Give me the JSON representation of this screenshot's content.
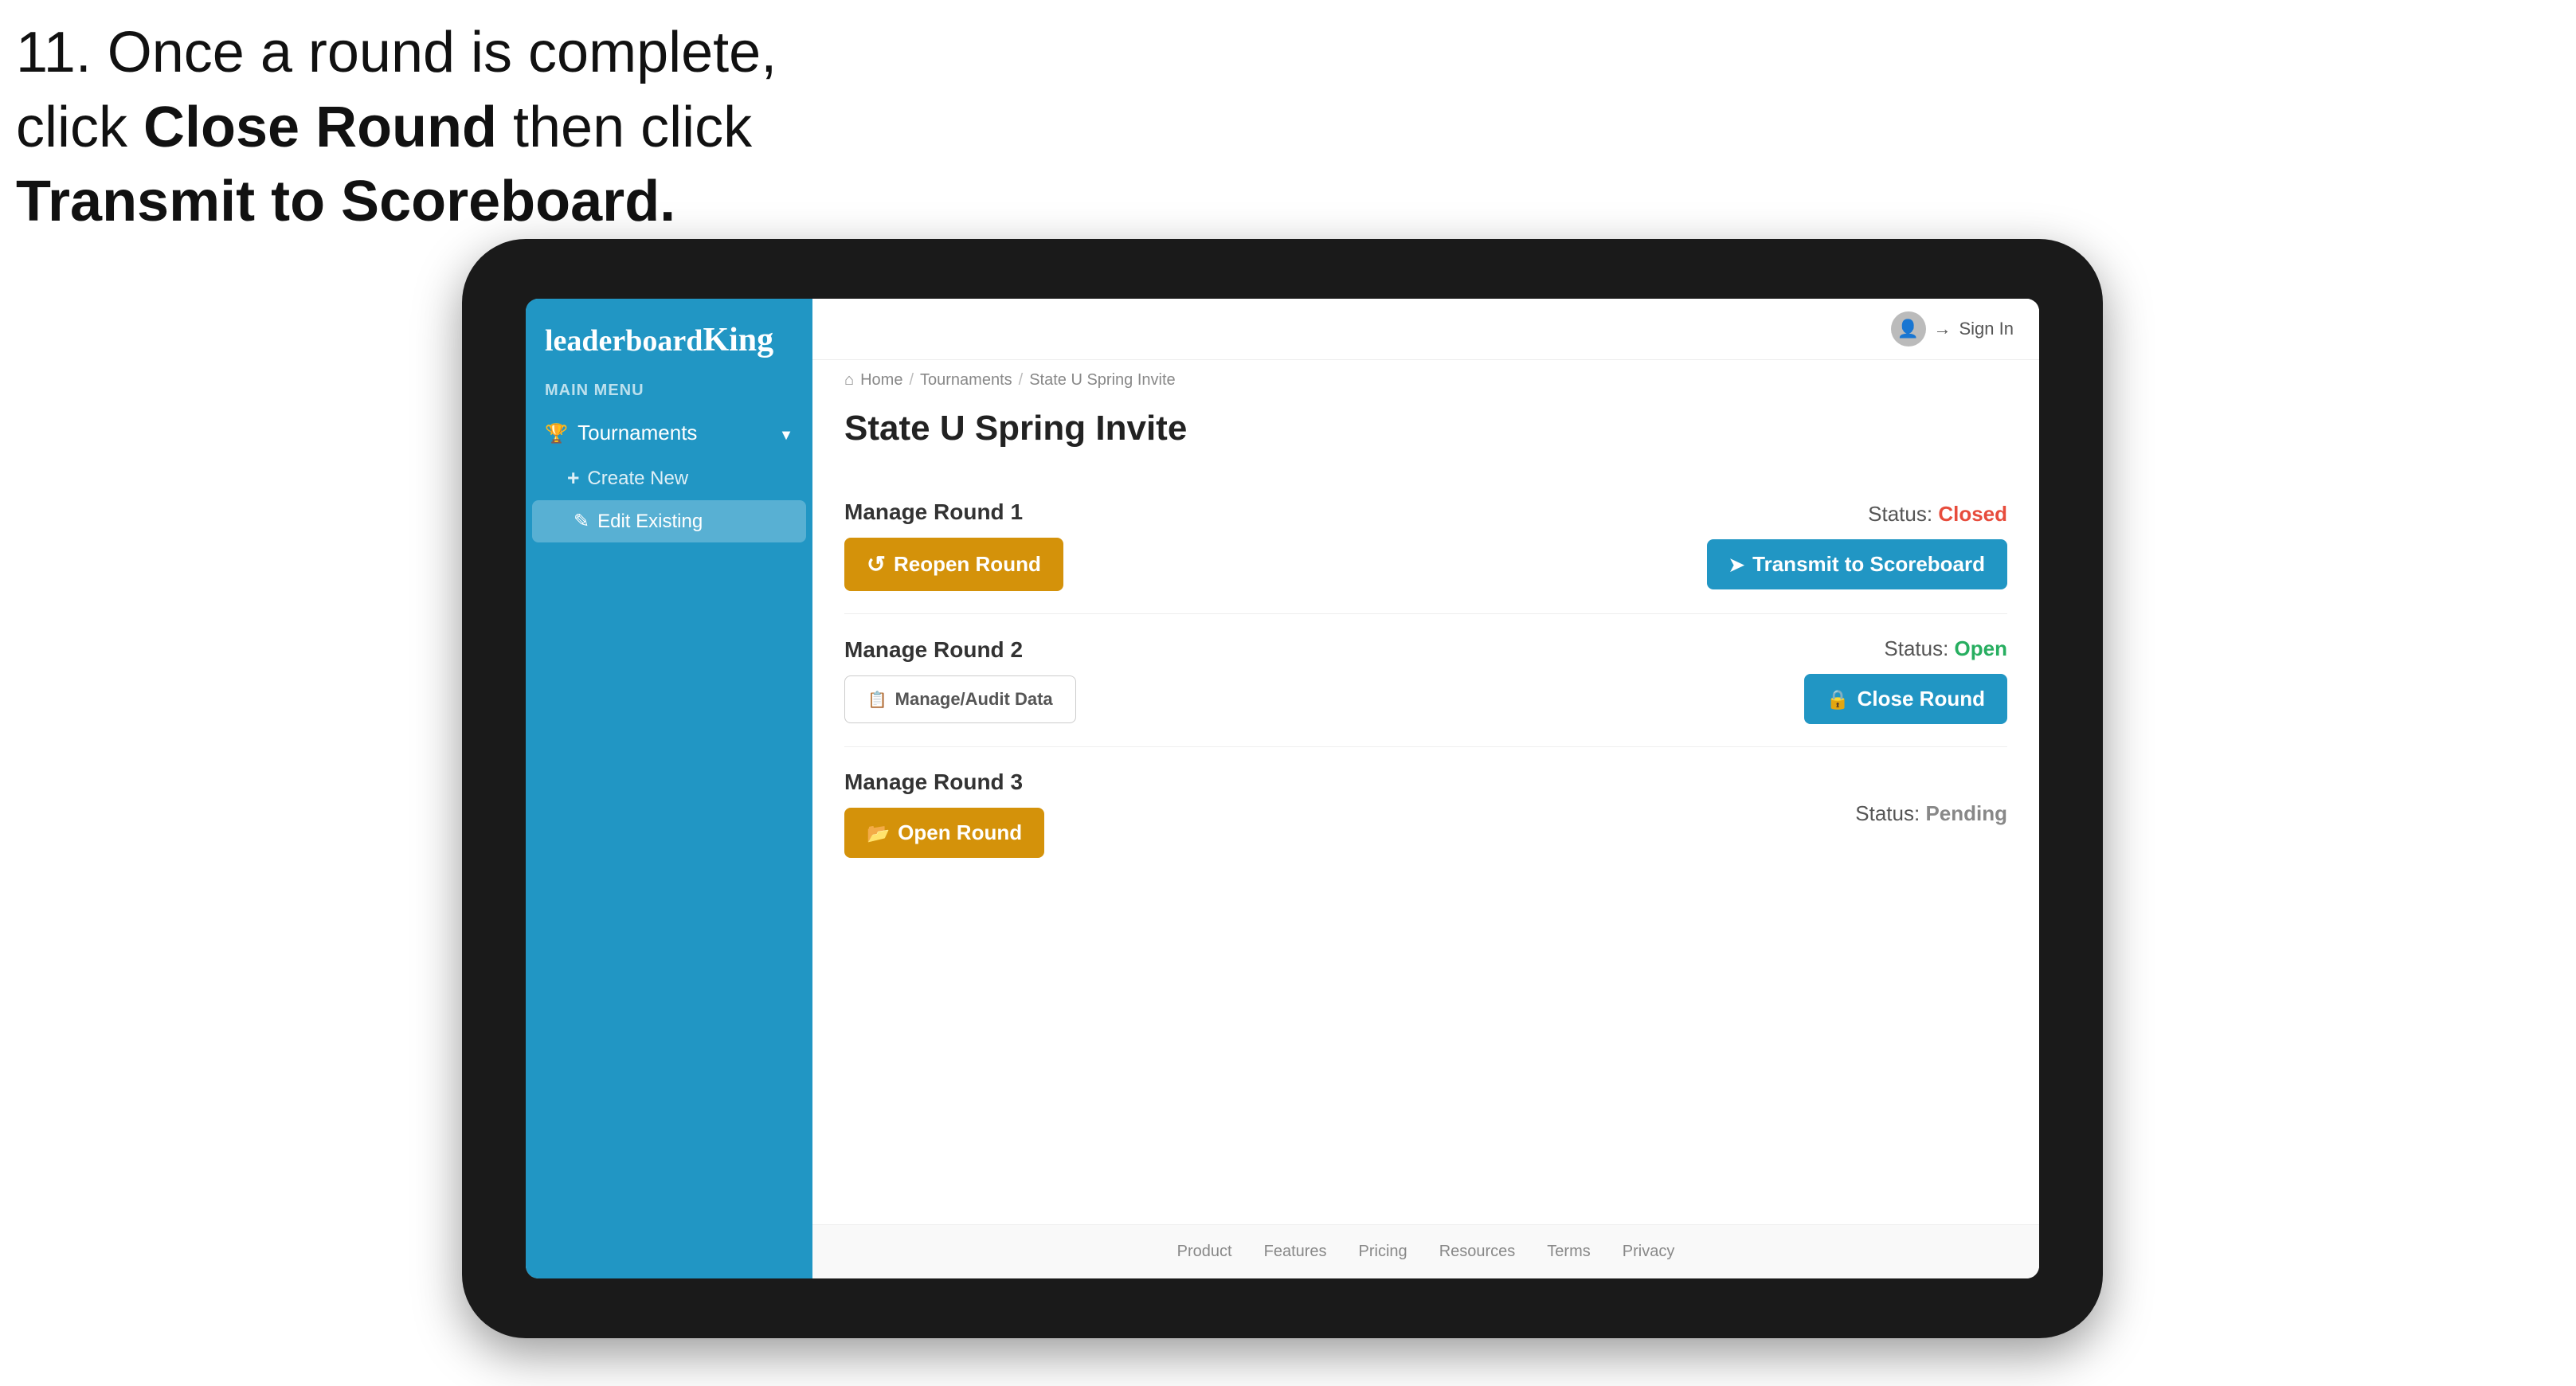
{
  "instruction": {
    "line1": "11. Once a round is complete,",
    "line2": "click ",
    "bold1": "Close Round",
    "line3": " then click",
    "bold2": "Transmit to Scoreboard."
  },
  "app": {
    "logo": {
      "text_normal": "leaderboard",
      "text_bold": "King"
    },
    "sidebar": {
      "menu_label": "MAIN MENU",
      "tournaments_label": "Tournaments",
      "create_new_label": "Create New",
      "edit_existing_label": "Edit Existing"
    },
    "topbar": {
      "signin_label": "Sign In"
    },
    "breadcrumb": {
      "home": "Home",
      "tournaments": "Tournaments",
      "current": "State U Spring Invite"
    },
    "page_title": "State U Spring Invite",
    "rounds": [
      {
        "id": "round1",
        "title": "Manage Round 1",
        "status_label": "Status:",
        "status_value": "Closed",
        "status_type": "closed",
        "primary_btn_label": "Reopen Round",
        "primary_btn_type": "gold",
        "secondary_btn_label": "Transmit to Scoreboard",
        "secondary_btn_type": "blue"
      },
      {
        "id": "round2",
        "title": "Manage Round 2",
        "status_label": "Status:",
        "status_value": "Open",
        "status_type": "open",
        "primary_btn_label": "Manage/Audit Data",
        "primary_btn_type": "outline",
        "secondary_btn_label": "Close Round",
        "secondary_btn_type": "blue"
      },
      {
        "id": "round3",
        "title": "Manage Round 3",
        "status_label": "Status:",
        "status_value": "Pending",
        "status_type": "pending",
        "primary_btn_label": "Open Round",
        "primary_btn_type": "gold",
        "secondary_btn_label": null,
        "secondary_btn_type": null
      }
    ],
    "footer": {
      "links": [
        "Product",
        "Features",
        "Pricing",
        "Resources",
        "Terms",
        "Privacy"
      ]
    }
  },
  "colors": {
    "sidebar_bg": "#2196c4",
    "btn_gold": "#d4920a",
    "btn_blue": "#2196c4",
    "status_closed": "#e74c3c",
    "status_open": "#27ae60",
    "status_pending": "#888888"
  }
}
